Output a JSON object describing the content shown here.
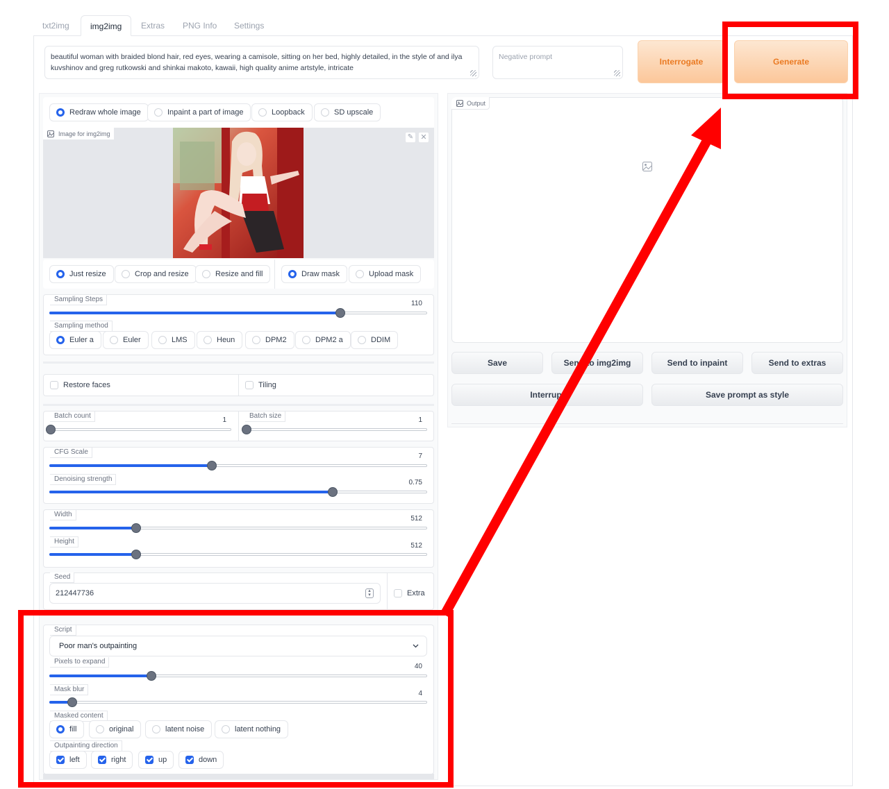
{
  "tabs": [
    "txt2img",
    "img2img",
    "Extras",
    "PNG Info",
    "Settings"
  ],
  "prompt": "beautiful woman with braided blond hair, red eyes, wearing a camisole, sitting on her bed, highly detailed, in the style of and ilya kuvshinov and greg rutkowski and shinkai makoto, kawaii, high quality anime artstyle, intricate",
  "negative_placeholder": "Negative prompt",
  "buttons": {
    "interrogate": "Interrogate",
    "generate": "Generate"
  },
  "mode_radios": [
    "Redraw whole image",
    "Inpaint a part of image",
    "Loopback",
    "SD upscale"
  ],
  "image_label": "Image for img2img",
  "resize_radios": [
    "Just resize",
    "Crop and resize",
    "Resize and fill"
  ],
  "mask_radios": [
    "Draw mask",
    "Upload mask"
  ],
  "sampling_steps": {
    "label": "Sampling Steps",
    "value": "110",
    "fraction": 0.77
  },
  "sampling_method": {
    "label": "Sampling method",
    "options": [
      "Euler a",
      "Euler",
      "LMS",
      "Heun",
      "DPM2",
      "DPM2 a",
      "DDIM"
    ]
  },
  "restore_faces": "Restore faces",
  "tiling": "Tiling",
  "batch_count": {
    "label": "Batch count",
    "value": "1",
    "fraction": 0
  },
  "batch_size": {
    "label": "Batch size",
    "value": "1",
    "fraction": 0
  },
  "cfg_scale": {
    "label": "CFG Scale",
    "value": "7",
    "fraction": 0.43
  },
  "denoising": {
    "label": "Denoising strength",
    "value": "0.75",
    "fraction": 0.75
  },
  "width": {
    "label": "Width",
    "value": "512",
    "fraction": 0.23
  },
  "height": {
    "label": "Height",
    "value": "512",
    "fraction": 0.23
  },
  "seed": {
    "label": "Seed",
    "value": "212447736"
  },
  "extra": "Extra",
  "script": {
    "label": "Script",
    "value": "Poor man's outpainting"
  },
  "pixels_to_expand": {
    "label": "Pixels to expand",
    "value": "40",
    "fraction": 0.27
  },
  "mask_blur": {
    "label": "Mask blur",
    "value": "4",
    "fraction": 0.06
  },
  "masked_content": {
    "label": "Masked content",
    "options": [
      "fill",
      "original",
      "latent noise",
      "latent nothing"
    ]
  },
  "outpainting_direction": {
    "label": "Outpainting direction",
    "options": [
      "left",
      "right",
      "up",
      "down"
    ]
  },
  "output_label": "Output",
  "output_buttons": [
    "Save",
    "Send to img2img",
    "Send to inpaint",
    "Send to extras"
  ],
  "output_buttons2": [
    "Interrupt",
    "Save prompt as style"
  ],
  "colors": {
    "accent": "#2563eb",
    "annotation": "#ff0000",
    "generate": "#ea7a22"
  }
}
